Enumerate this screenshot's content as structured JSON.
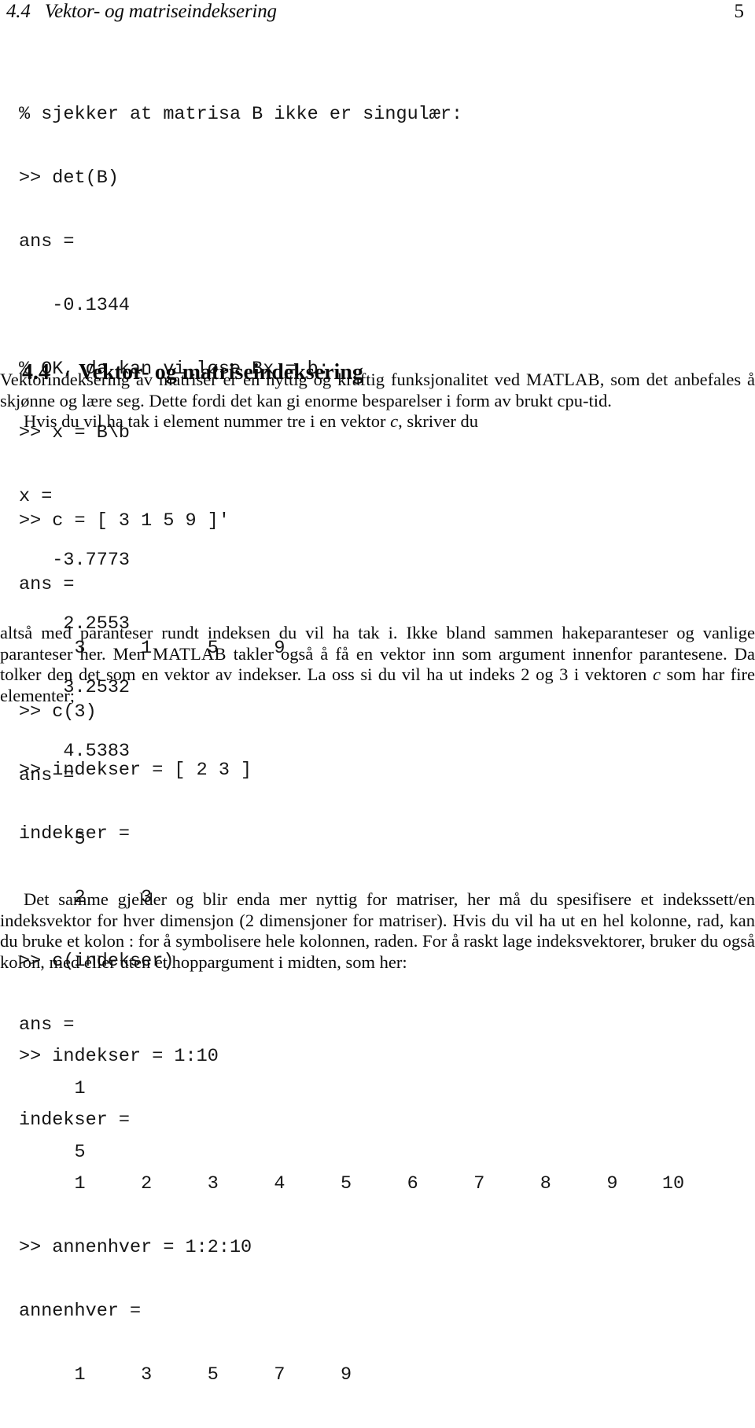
{
  "page": {
    "number": "5",
    "running_head": "4.4   Vektor- og matriseindeksering"
  },
  "section": {
    "number": "4.4",
    "title": "Vektor- og matriseindeksering"
  },
  "code_blocks": [
    {
      "name": "code-block-determinant-solve",
      "lines": [
        "% sjekker at matrisa B ikke er singulær:",
        ">> det(B)",
        "ans =",
        "   -0.1344",
        "% OK, da kan vi løse Bx = b:",
        ">> x = B\\b",
        "x =",
        "   -3.7773",
        "    2.2553",
        "    3.2532",
        "    4.5383"
      ]
    },
    {
      "name": "code-block-vector-index",
      "lines": [
        ">> c = [ 3 1 5 9 ]'",
        "ans =",
        "     3     1     5     9",
        ">> c(3)",
        "ans =",
        "     5"
      ]
    },
    {
      "name": "code-block-index-vector",
      "lines": [
        ">> indekser = [ 2 3 ]",
        "indekser =",
        "     2     3",
        ">> c(indekser)",
        "ans =",
        "     1",
        "     5"
      ]
    },
    {
      "name": "code-block-colon-ranges",
      "lines": [
        ">> indekser = 1:10",
        "indekser =",
        "     1     2     3     4     5     6     7     8     9    10",
        ">> annenhver = 1:2:10",
        "annenhver =",
        "     1     3     5     7     9"
      ]
    }
  ],
  "paragraphs": {
    "intro_part1": "Vektorindeksering av matriser er en nyttig og kraftig funksjonalitet ved ",
    "intro_matlab": "MATLAB",
    "intro_part2": ", som det anbefales å skjønne og lære seg. Dette fordi det kan gi enorme besparelser i form av brukt cpu-tid.",
    "intro_line2": "Hvis du vil ha tak i element nummer tre i en vektor ",
    "intro_var_c": "c",
    "intro_line2_end": ", skriver du",
    "middle_part1": "altså med paranteser rundt indeksen du vil ha tak i. Ikke bland sammen hakeparanteser og vanlige paranteser her. Men ",
    "middle_matlab": "MATLAB",
    "middle_part2": " takler også å få en vektor inn som argument innenfor parantesene. Da tolker den det som en vektor av indekser. La oss si du vil ha ut indeks 2 og 3 i vektoren ",
    "middle_var_c": "c",
    "middle_part3": " som har fire elementer;",
    "last": "Det samme gjelder og blir enda mer nyttig for matriser, her må du spesifisere et indekssett/en indeksvektor for hver dimensjon (2 dimensjoner for matriser). Hvis du vil ha ut en hel kolonne, rad, kan du bruke et kolon : for å symbolisere hele kolonnen, raden. For å raskt lage indeksvektorer, bruker du også kolon, med eller uten et hoppargument i midten, som her:"
  }
}
